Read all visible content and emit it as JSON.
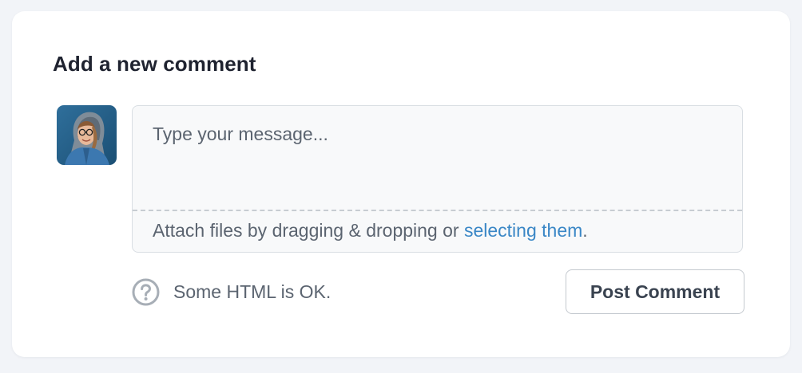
{
  "form": {
    "title": "Add a new comment",
    "avatar_alt": "User avatar",
    "message_placeholder": "Type your message...",
    "message_value": "",
    "attach_prefix": "Attach files by dragging & dropping or ",
    "attach_link": "selecting them",
    "attach_suffix": ".",
    "help_icon": "question-circle-icon",
    "help_text": "Some HTML is OK.",
    "submit_label": "Post Comment"
  },
  "colors": {
    "background": "#f2f4f8",
    "card": "#ffffff",
    "title": "#1f2330",
    "body_text": "#5b6470",
    "link": "#3a87c6",
    "border": "#d9dee3"
  }
}
